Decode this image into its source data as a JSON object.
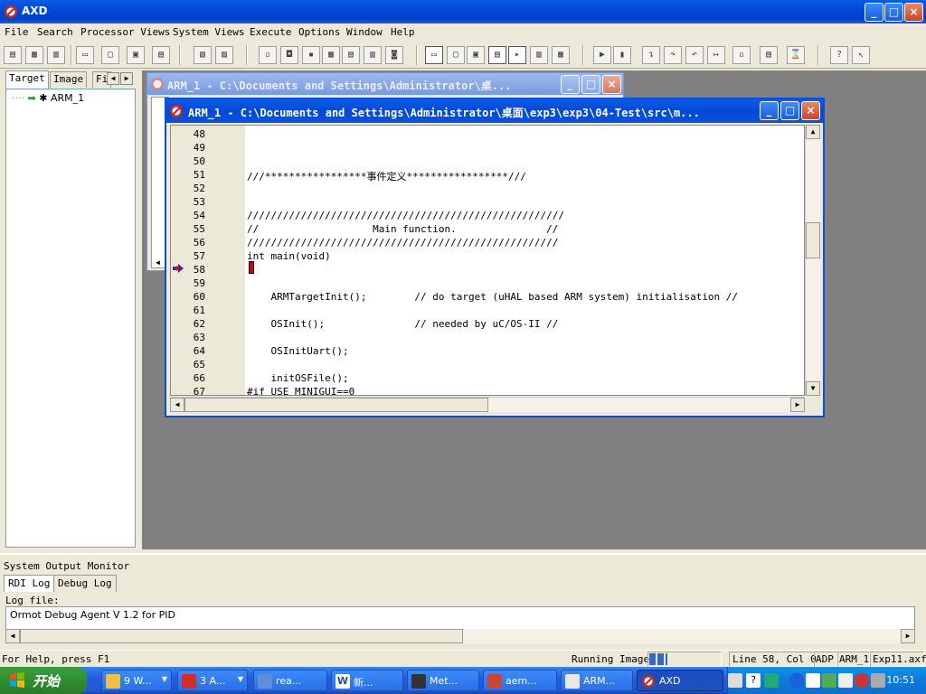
{
  "window": {
    "title": "AXD",
    "minimize": "_",
    "maximize": "□",
    "close": "×"
  },
  "menu": [
    "File",
    "Search",
    "Processor Views",
    "System Views",
    "Execute",
    "Options",
    "Window",
    "Help"
  ],
  "left_panel": {
    "tabs": [
      "Target",
      "Image",
      "Fi"
    ],
    "tree_node": "ARM_1"
  },
  "bg_window": {
    "title": "ARM_1 - C:\\Documents and Settings\\Administrator\\桌..."
  },
  "fg_window": {
    "title": "ARM_1 - C:\\Documents and Settings\\Administrator\\桌面\\exp3\\exp3\\04-Test\\src\\m..."
  },
  "code": {
    "line_numbers": [
      "48",
      "49",
      "50",
      "51",
      "52",
      "53",
      "54",
      "55",
      "56",
      "57",
      "58",
      "59",
      "60",
      "61",
      "62",
      "63",
      "64",
      "65",
      "66",
      "67"
    ],
    "lines": [
      "",
      "",
      "",
      "///*****************事件定义*****************///",
      "",
      "",
      "/////////////////////////////////////////////////////",
      "//                   Main function.               //",
      "////////////////////////////////////////////////////",
      "int main(void)",
      "",
      "",
      "    ARMTargetInit();        // do target (uHAL based ARM system) initialisation //",
      "",
      "    OSInit();               // needed by uC/OS-II //",
      "",
      "    OSInitUart();",
      "",
      "    initOSFile();",
      "#if USE_MINIGUI==0"
    ]
  },
  "output": {
    "title": "System Output Monitor",
    "tabs": [
      "RDI Log",
      "Debug Log"
    ],
    "log_label": "Log file:",
    "log_text": "Ormot Debug Agent V 1.2 for PID"
  },
  "status": {
    "help": "For Help, press F1",
    "running": "Running Image",
    "progress": 0.25,
    "position": "Line 58, Col 0",
    "mode": "ADP",
    "target": "ARM_1",
    "file": "Exp11.axf"
  },
  "taskbar": {
    "start": "开始",
    "tasks": [
      "9 W...",
      "3 A...",
      "rea...",
      "新...",
      "Met...",
      "aem...",
      "ARM...",
      "AXD"
    ],
    "clock": "10:51"
  }
}
